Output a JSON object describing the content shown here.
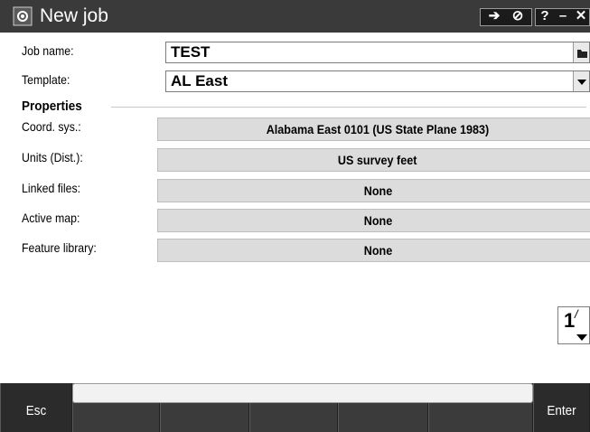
{
  "window": {
    "title": "New job",
    "icon": "gear-cube-icon"
  },
  "title_bar": {
    "buttons": [
      {
        "name": "connect-icon",
        "glyph": "➔"
      },
      {
        "name": "no-entry-icon",
        "glyph": "⊘"
      },
      {
        "name": "help-icon",
        "glyph": "?"
      },
      {
        "name": "minimize-icon",
        "glyph": "–"
      },
      {
        "name": "close-icon",
        "glyph": "✕"
      }
    ]
  },
  "form": {
    "job_name": {
      "label": "Job name:",
      "value": "TEST",
      "side_icon": "folder-icon"
    },
    "template": {
      "label": "Template:",
      "value": "AL East",
      "side_icon": "chevron-down-icon"
    }
  },
  "properties": {
    "title": "Properties",
    "rows": [
      {
        "label": "Coord. sys.:",
        "value": "Alabama East 0101 (US State Plane 1983)"
      },
      {
        "label": "Units (Dist.):",
        "value": "US survey feet"
      },
      {
        "label": "Linked files:",
        "value": "None"
      },
      {
        "label": "Active map:",
        "value": "None"
      },
      {
        "label": "Feature library:",
        "value": "None"
      }
    ]
  },
  "page_indicator": {
    "number": "1",
    "slash": "/"
  },
  "softkeys": {
    "esc": "Esc",
    "enter": "Enter"
  },
  "status_line": {
    "text": ""
  },
  "colors": {
    "title_bar": "#3a3a3a",
    "footer": "#2f2f2f",
    "property_button": "#dcdcdc"
  }
}
